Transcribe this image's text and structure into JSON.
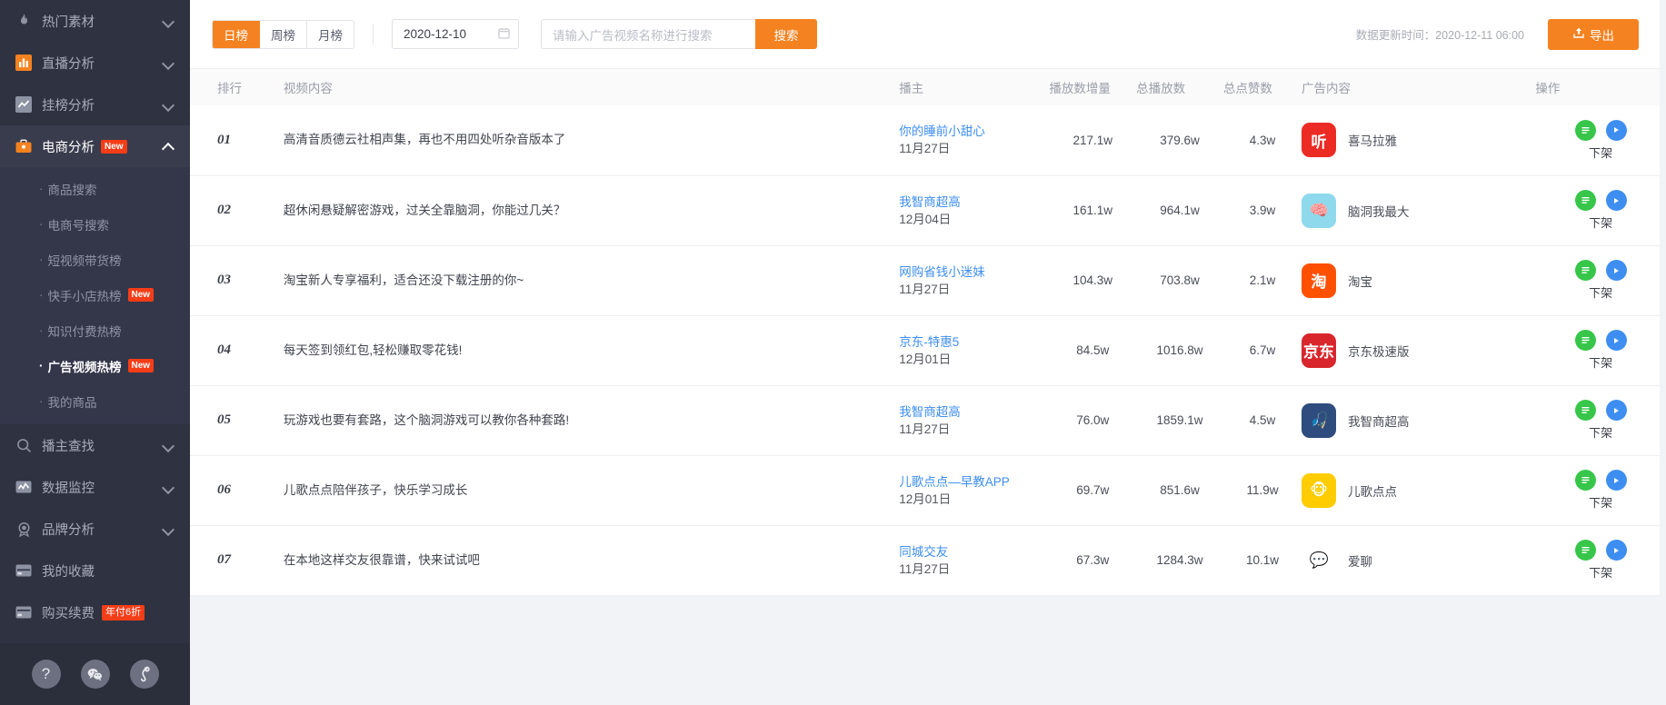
{
  "sidebar": {
    "items": [
      {
        "label": "热门素材",
        "icon": "fire-icon",
        "expandable": true,
        "active": false
      },
      {
        "label": "直播分析",
        "icon": "bar-chart-icon",
        "expandable": true,
        "active": false
      },
      {
        "label": "挂榜分析",
        "icon": "line-chart-icon",
        "expandable": true,
        "active": false
      },
      {
        "label": "电商分析",
        "icon": "briefcase-icon",
        "expandable": true,
        "active": true,
        "badge": "New"
      }
    ],
    "submenu": [
      {
        "label": "商品搜索",
        "active": false
      },
      {
        "label": "电商号搜索",
        "active": false
      },
      {
        "label": "短视频带货榜",
        "active": false
      },
      {
        "label": "快手小店热榜",
        "active": false,
        "badge": "New"
      },
      {
        "label": "知识付费热榜",
        "active": false
      },
      {
        "label": "广告视频热榜",
        "active": true,
        "badge": "New"
      },
      {
        "label": "我的商品",
        "active": false
      }
    ],
    "items_bottom": [
      {
        "label": "播主查找",
        "icon": "search-icon",
        "expandable": true
      },
      {
        "label": "数据监控",
        "icon": "monitor-icon",
        "expandable": true
      },
      {
        "label": "品牌分析",
        "icon": "medal-icon",
        "expandable": true
      },
      {
        "label": "我的收藏",
        "icon": "card-icon",
        "expandable": false
      },
      {
        "label": "购买续费",
        "icon": "wallet-icon",
        "expandable": false,
        "badge": "年付6折"
      }
    ],
    "footer_buttons": [
      {
        "name": "help-icon",
        "glyph": "?"
      },
      {
        "name": "wechat-icon",
        "glyph": "ⓦ"
      },
      {
        "name": "link-icon",
        "glyph": "ʃ"
      }
    ]
  },
  "toolbar": {
    "tabs": [
      {
        "label": "日榜",
        "active": true
      },
      {
        "label": "周榜",
        "active": false
      },
      {
        "label": "月榜",
        "active": false
      }
    ],
    "date_value": "2020-12-10",
    "search_placeholder": "请输入广告视频名称进行搜索",
    "search_value": "",
    "search_button": "搜索",
    "update_time": "数据更新时间：2020-12-11 06:00",
    "export_label": "导出"
  },
  "table": {
    "columns": [
      "排行",
      "视频内容",
      "播主",
      "播放数增量",
      "总播放数",
      "总点赞数",
      "广告内容",
      "操作"
    ],
    "rows": [
      {
        "rank": "01",
        "video": "高清音质德云社相声集，再也不用四处听杂音版本了",
        "author": "你的睡前小甜心",
        "date": "11月27日",
        "increment": "217.1w",
        "total_play": "379.6w",
        "total_like": "4.3w",
        "ad_name": "喜马拉雅",
        "ad_icon_text": "听",
        "ad_icon_bg": "#ec2b25",
        "ad_icon_fg": "#ffffff",
        "op_label": "下架"
      },
      {
        "rank": "02",
        "video": "超休闲悬疑解密游戏，过关全靠脑洞，你能过几关？",
        "author": "我智商超高",
        "date": "12月04日",
        "increment": "161.1w",
        "total_play": "964.1w",
        "total_like": "3.9w",
        "ad_name": "脑洞我最大",
        "ad_icon_text": "🧠",
        "ad_icon_bg": "#8ed9ec",
        "ad_icon_fg": "#ffffff",
        "op_label": "下架"
      },
      {
        "rank": "03",
        "video": "淘宝新人专享福利，适合还没下载注册的你~",
        "author": "网购省钱小迷妹",
        "date": "11月27日",
        "increment": "104.3w",
        "total_play": "703.8w",
        "total_like": "2.1w",
        "ad_name": "淘宝",
        "ad_icon_text": "淘",
        "ad_icon_bg": "#ff5000",
        "ad_icon_fg": "#ffffff",
        "op_label": "下架"
      },
      {
        "rank": "04",
        "video": "每天签到领红包,轻松赚取零花钱!",
        "author": "京东-特惠5",
        "date": "12月01日",
        "increment": "84.5w",
        "total_play": "1016.8w",
        "total_like": "6.7w",
        "ad_name": "京东极速版",
        "ad_icon_text": "京东",
        "ad_icon_bg": "#d8262c",
        "ad_icon_fg": "#ffffff",
        "op_label": "下架"
      },
      {
        "rank": "05",
        "video": "玩游戏也要有套路，这个脑洞游戏可以教你各种套路!",
        "author": "我智商超高",
        "date": "11月27日",
        "increment": "76.0w",
        "total_play": "1859.1w",
        "total_like": "4.5w",
        "ad_name": "我智商超高",
        "ad_icon_text": "🎣",
        "ad_icon_bg": "#2e4c7d",
        "ad_icon_fg": "#ffffff",
        "op_label": "下架"
      },
      {
        "rank": "06",
        "video": "儿歌点点陪伴孩子，快乐学习成长",
        "author": "儿歌点点—早教APP",
        "date": "12月01日",
        "increment": "69.7w",
        "total_play": "851.6w",
        "total_like": "11.9w",
        "ad_name": "儿歌点点",
        "ad_icon_text": "🐵",
        "ad_icon_bg": "#ffcc00",
        "ad_icon_fg": "#ffffff",
        "op_label": "下架"
      },
      {
        "rank": "07",
        "video": "在本地这样交友很靠谱，快来试试吧",
        "author": "同城交友",
        "date": "11月27日",
        "increment": "67.3w",
        "total_play": "1284.3w",
        "total_like": "10.1w",
        "ad_name": "爱聊",
        "ad_icon_text": "💬",
        "ad_icon_bg": "#ffffff",
        "ad_icon_fg": "#f0509b",
        "op_label": "下架"
      }
    ]
  },
  "colors": {
    "accent": "#f58220",
    "link": "#3d8ef0",
    "sidebar_bg": "#2f3241",
    "badge": "#f53d18",
    "green": "#37c64a",
    "blue": "#3d8ef0"
  }
}
